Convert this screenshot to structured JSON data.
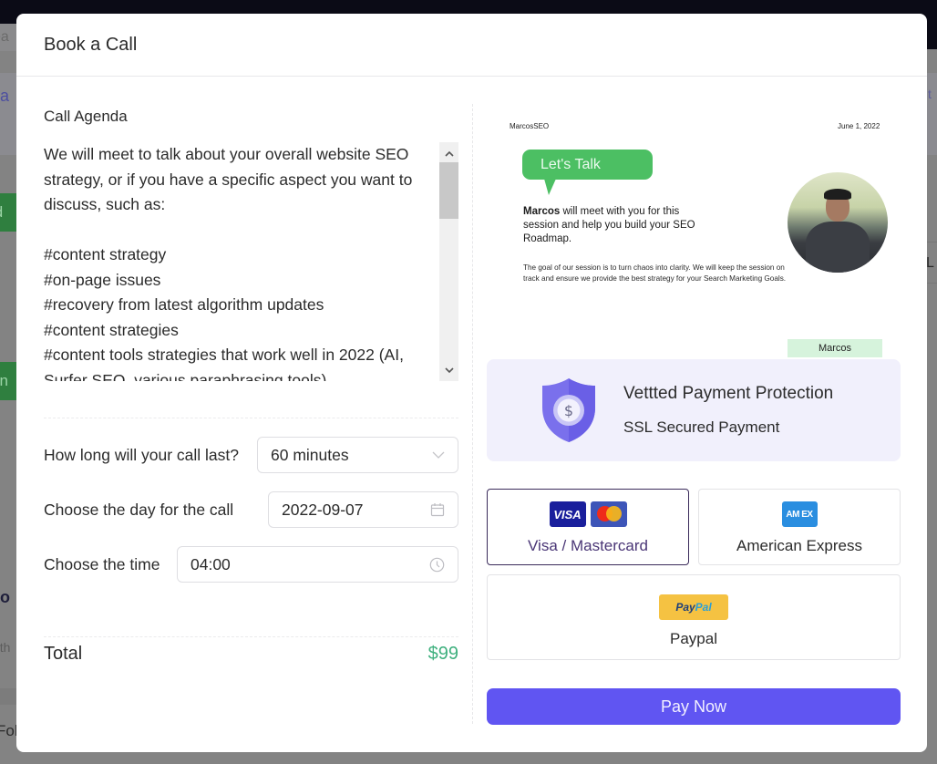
{
  "background": {
    "search_fragment": "ea",
    "link_fragment": "ea",
    "green_button_1_fragment": "ld",
    "green_button_2_fragment": "en",
    "dark_fragment": "o",
    "grey_fragment": "t th",
    "bottom_fragment": "Fol",
    "right_fragment": "L",
    "right_top_fragment": "t"
  },
  "modal": {
    "title": "Book a Call"
  },
  "agenda": {
    "label": "Call Agenda",
    "text": "We will meet to talk about your overall website SEO strategy, or if you have a specific aspect you want to discuss, such as:\n\n#content strategy\n#on-page issues\n#recovery from latest algorithm updates\n#content strategies\n#content tools strategies that work well in 2022 (AI, Surfer SEO, various paraphrasing tools)",
    "scroll_up_icon": "chevron-up-icon",
    "scroll_down_icon": "chevron-down-icon"
  },
  "form": {
    "duration": {
      "label": "How long will your call last?",
      "value": "60 minutes",
      "icon": "chevron-down-icon"
    },
    "day": {
      "label": "Choose the day for the call",
      "value": "2022-09-07",
      "icon": "calendar-icon"
    },
    "time": {
      "label": "Choose the time",
      "value": "04:00",
      "icon": "clock-icon"
    }
  },
  "total": {
    "label": "Total",
    "value": "$99",
    "color": "#3fb07e"
  },
  "promo": {
    "brand": "MarcosSEO",
    "date": "June 1, 2022",
    "bubble": "Let's Talk",
    "headline_name": "Marcos",
    "headline_rest": " will meet with you for this session and help you build your SEO Roadmap.",
    "body": "The goal of our session is to turn chaos into clarity.  We will keep the session on track and ensure we provide the best strategy for your Search Marketing Goals.",
    "name_tag": "Marcos"
  },
  "protection": {
    "title": "Vettted Payment Protection",
    "subtitle": "SSL Secured Payment",
    "icon": "shield-dollar-icon"
  },
  "payment_methods": [
    {
      "label": "Visa / Mastercard",
      "logos": [
        "VISA",
        "mastercard"
      ],
      "selected": true
    },
    {
      "label": "American Express",
      "logos": [
        "AMEX"
      ],
      "selected": false
    },
    {
      "label": "Paypal",
      "logos": [
        "PayPal"
      ],
      "selected": false
    }
  ],
  "logos": {
    "visa": "VISA",
    "amex": "AM EX",
    "paypal_1": "Pay",
    "paypal_2": "Pal"
  },
  "actions": {
    "pay_now": "Pay Now"
  },
  "colors": {
    "accent": "#6055f2",
    "protect_bg": "#f1f0fc",
    "bubble_green": "#4cbf63",
    "total_green": "#3fb07e"
  }
}
